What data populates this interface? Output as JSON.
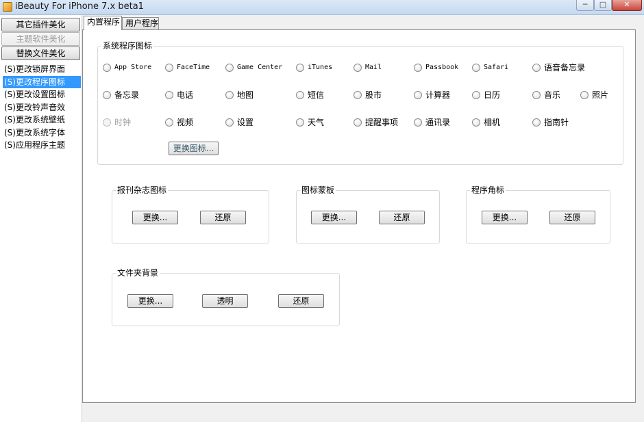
{
  "window": {
    "title": "iBeauty For iPhone 7.x beta1",
    "min_glyph": "─",
    "max_glyph": "□",
    "close_glyph": "✕"
  },
  "sidebar": {
    "buttons": [
      {
        "label": "其它插件美化",
        "enabled": true
      },
      {
        "label": "主题软件美化",
        "enabled": false
      },
      {
        "label": "替换文件美化",
        "enabled": true
      }
    ],
    "items": [
      {
        "label": "(S)更改锁屏界面",
        "selected": false
      },
      {
        "label": "(S)更改程序图标",
        "selected": true
      },
      {
        "label": "(S)更改设置图标",
        "selected": false
      },
      {
        "label": "(S)更改铃声音效",
        "selected": false
      },
      {
        "label": "(S)更改系统壁纸",
        "selected": false
      },
      {
        "label": "(S)更改系统字体",
        "selected": false
      },
      {
        "label": "(S)应用程序主题",
        "selected": false
      }
    ]
  },
  "tabs": [
    {
      "label": "内置程序",
      "active": true
    },
    {
      "label": "用户程序",
      "active": false
    }
  ],
  "system_icons": {
    "title": "系统程序图标",
    "apps": [
      {
        "label": "App Store",
        "enabled": true
      },
      {
        "label": "FaceTime",
        "enabled": true
      },
      {
        "label": "Game Center",
        "enabled": true
      },
      {
        "label": "iTunes",
        "enabled": true
      },
      {
        "label": "Mail",
        "enabled": true
      },
      {
        "label": "Passbook",
        "enabled": true
      },
      {
        "label": "Safari",
        "enabled": true
      },
      {
        "label": "语音备忘录",
        "enabled": true
      },
      {
        "label": "备忘录",
        "enabled": true
      },
      {
        "label": "电话",
        "enabled": true
      },
      {
        "label": "地图",
        "enabled": true
      },
      {
        "label": "短信",
        "enabled": true
      },
      {
        "label": "股市",
        "enabled": true
      },
      {
        "label": "计算器",
        "enabled": true
      },
      {
        "label": "日历",
        "enabled": true
      },
      {
        "label": "音乐",
        "enabled": true
      },
      {
        "label": "照片",
        "enabled": true
      },
      {
        "label": "时钟",
        "enabled": false
      },
      {
        "label": "视频",
        "enabled": true
      },
      {
        "label": "设置",
        "enabled": true
      },
      {
        "label": "天气",
        "enabled": true
      },
      {
        "label": "提醒事项",
        "enabled": true
      },
      {
        "label": "通讯录",
        "enabled": true
      },
      {
        "label": "相机",
        "enabled": true
      },
      {
        "label": "指南针",
        "enabled": true
      }
    ],
    "change_button": "更换图标..."
  },
  "newsstand": {
    "title": "报刊杂志图标",
    "change": "更换...",
    "restore": "还原"
  },
  "icon_mask": {
    "title": "图标蒙板",
    "change": "更换...",
    "restore": "还原"
  },
  "badge": {
    "title": "程序角标",
    "change": "更换...",
    "restore": "还原"
  },
  "folder_bg": {
    "title": "文件夹背景",
    "change": "更换...",
    "transparent": "透明",
    "restore": "还原"
  }
}
